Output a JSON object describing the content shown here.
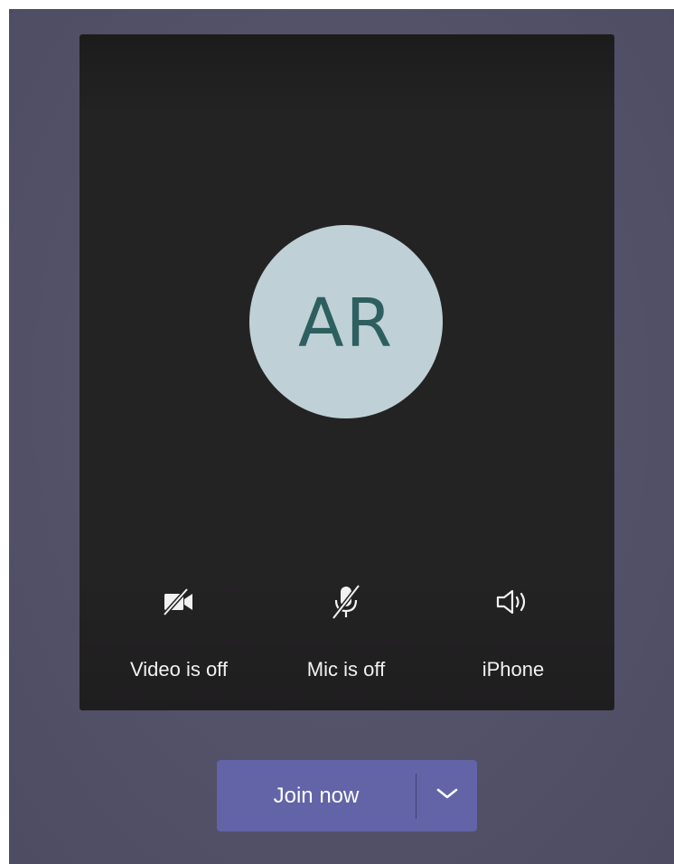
{
  "preview": {
    "avatar_initials": "AR"
  },
  "controls": {
    "video": {
      "label": "Video is off",
      "icon": "video-off-icon"
    },
    "mic": {
      "label": "Mic is off",
      "icon": "mic-off-icon"
    },
    "audio": {
      "label": "iPhone",
      "icon": "speaker-icon"
    }
  },
  "join": {
    "label": "Join now",
    "dropdown_icon": "chevron-down-icon"
  },
  "colors": {
    "background": "#545268",
    "preview": "#242324",
    "avatar_bg": "#bfd1d6",
    "avatar_text": "#2e5f60",
    "accent": "#6264a7"
  }
}
